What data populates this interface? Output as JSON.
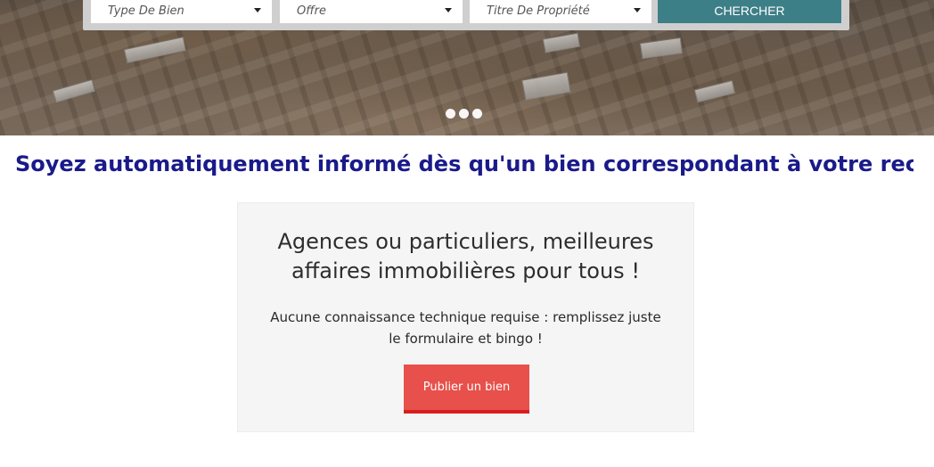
{
  "search": {
    "type_placeholder": "Type De Bien",
    "offre_placeholder": "Offre",
    "titre_placeholder": "Titre De Propriété",
    "button_label": "CHERCHER"
  },
  "carousel": {
    "slide_count": 3
  },
  "marquee": {
    "text": "Soyez automatiquement informé dès qu'un bien correspondant à votre rec"
  },
  "cta": {
    "title": "Agences ou particuliers, meilleures affaires immobilières pour tous !",
    "description": "Aucune connaissance technique requise : remplissez juste le formulaire et bingo !",
    "button_label": "Publier un bien"
  },
  "colors": {
    "search_button": "#3d7f87",
    "marquee_text": "#1a1a8a",
    "publish_button": "#e8504b",
    "publish_button_border": "#d81f1f"
  }
}
